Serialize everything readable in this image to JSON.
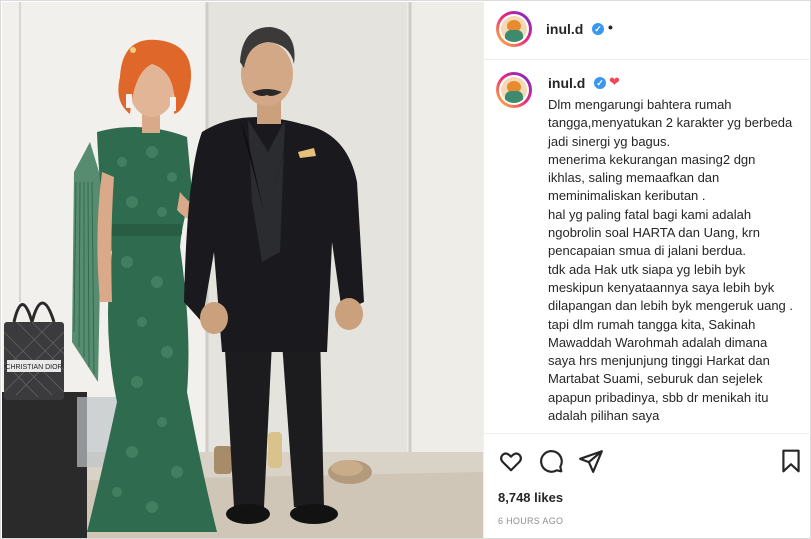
{
  "post": {
    "username": "inul.d",
    "header_dot": "•",
    "caption_username": "inul.d",
    "caption_text": "Dlm mengarungi bahtera rumah tangga,menyatukan 2 karakter yg berbeda jadi sinergi yg bagus.\nmenerima kekurangan masing2 dgn ikhlas, saling memaafkan dan meminimaliskan keributan .\nhal yg paling fatal bagi kami adalah ngobrolin soal HARTA dan Uang, krn pencapaian smua di jalani berdua.\ntdk ada Hak utk siapa yg lebih byk meskipun kenyataannya saya lebih byk dilapangan dan lebih byk mengeruk uang .\ntapi dlm rumah tangga kita, Sakinah Mawaddah Warohmah adalah dimana saya hrs menjunjung tinggi Harkat dan Martabat Suami, seburuk dan sejelek apapun pribadinya, sbb dr menikah itu adalah pilihan saya",
    "likes": "8,748 likes",
    "timestamp": "6 HOURS AGO"
  },
  "photo": {
    "bag_text": "CHRISTIAN DIOR"
  },
  "icons": {
    "like": "heart-outline-icon",
    "comment": "comment-icon",
    "share": "paper-plane-icon",
    "save": "bookmark-icon",
    "verified": "verified-badge-icon"
  },
  "colors": {
    "verified_blue": "#3897f0",
    "heart_red": "#ed4956",
    "dress_green": "#2f6b4f",
    "hair_orange": "#e0672a",
    "suit_black": "#1a1a1e"
  }
}
